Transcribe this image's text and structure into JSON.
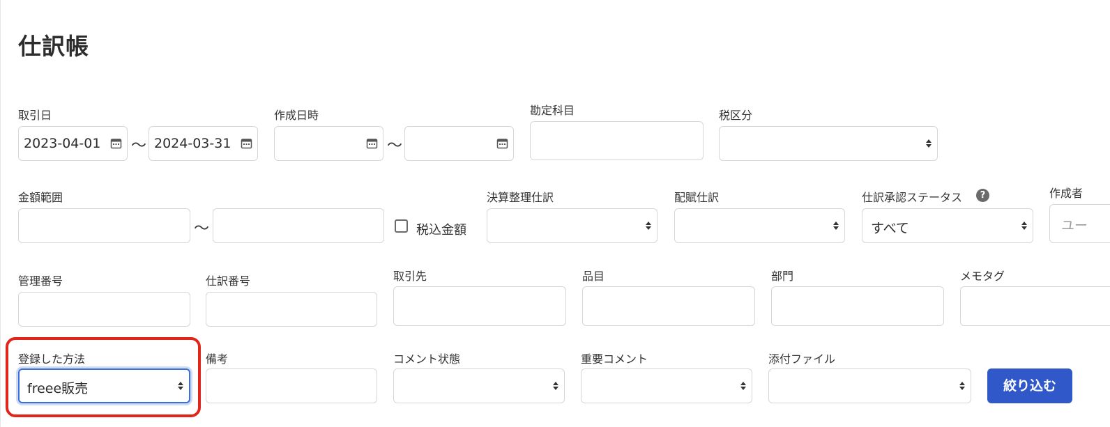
{
  "page": {
    "title": "仕訳帳"
  },
  "filters": {
    "transaction_date": {
      "label": "取引日",
      "from": "2023-04-01",
      "to": "2024-03-31",
      "separator": "〜"
    },
    "created_at": {
      "label": "作成日時",
      "from": "",
      "to": "",
      "separator": "〜"
    },
    "account_item": {
      "label": "勘定科目",
      "value": ""
    },
    "tax_category": {
      "label": "税区分",
      "value": ""
    },
    "amount_range": {
      "label": "金額範囲",
      "from": "",
      "to": "",
      "separator": "〜"
    },
    "tax_included": {
      "label": "税込金額",
      "checked": false
    },
    "closing_adjustment": {
      "label": "決算整理仕訳",
      "value": ""
    },
    "allocation": {
      "label": "配賦仕訳",
      "value": ""
    },
    "approval_status": {
      "label": "仕訳承認ステータス",
      "value": "すべて",
      "help_icon": "?"
    },
    "creator": {
      "label": "作成者",
      "placeholder": "ユー"
    },
    "management_number": {
      "label": "管理番号",
      "value": ""
    },
    "journal_number": {
      "label": "仕訳番号",
      "value": ""
    },
    "partner": {
      "label": "取引先",
      "value": ""
    },
    "item": {
      "label": "品目",
      "value": ""
    },
    "section": {
      "label": "部門",
      "value": ""
    },
    "memo_tag": {
      "label": "メモタグ",
      "value": ""
    },
    "registration_method": {
      "label": "登録した方法",
      "value": "freee販売"
    },
    "remarks": {
      "label": "備考",
      "value": ""
    },
    "comment_status": {
      "label": "コメント状態",
      "value": ""
    },
    "important_comment": {
      "label": "重要コメント",
      "value": ""
    },
    "attachment": {
      "label": "添付ファイル",
      "value": ""
    }
  },
  "actions": {
    "filter_button": "絞り込む"
  },
  "colors": {
    "accent": "#3058c8",
    "highlight": "#e1251b",
    "focus": "#3b6fd8"
  },
  "icons": [
    "calendar-icon",
    "select-arrows-icon",
    "help-icon",
    "checkbox-icon"
  ]
}
